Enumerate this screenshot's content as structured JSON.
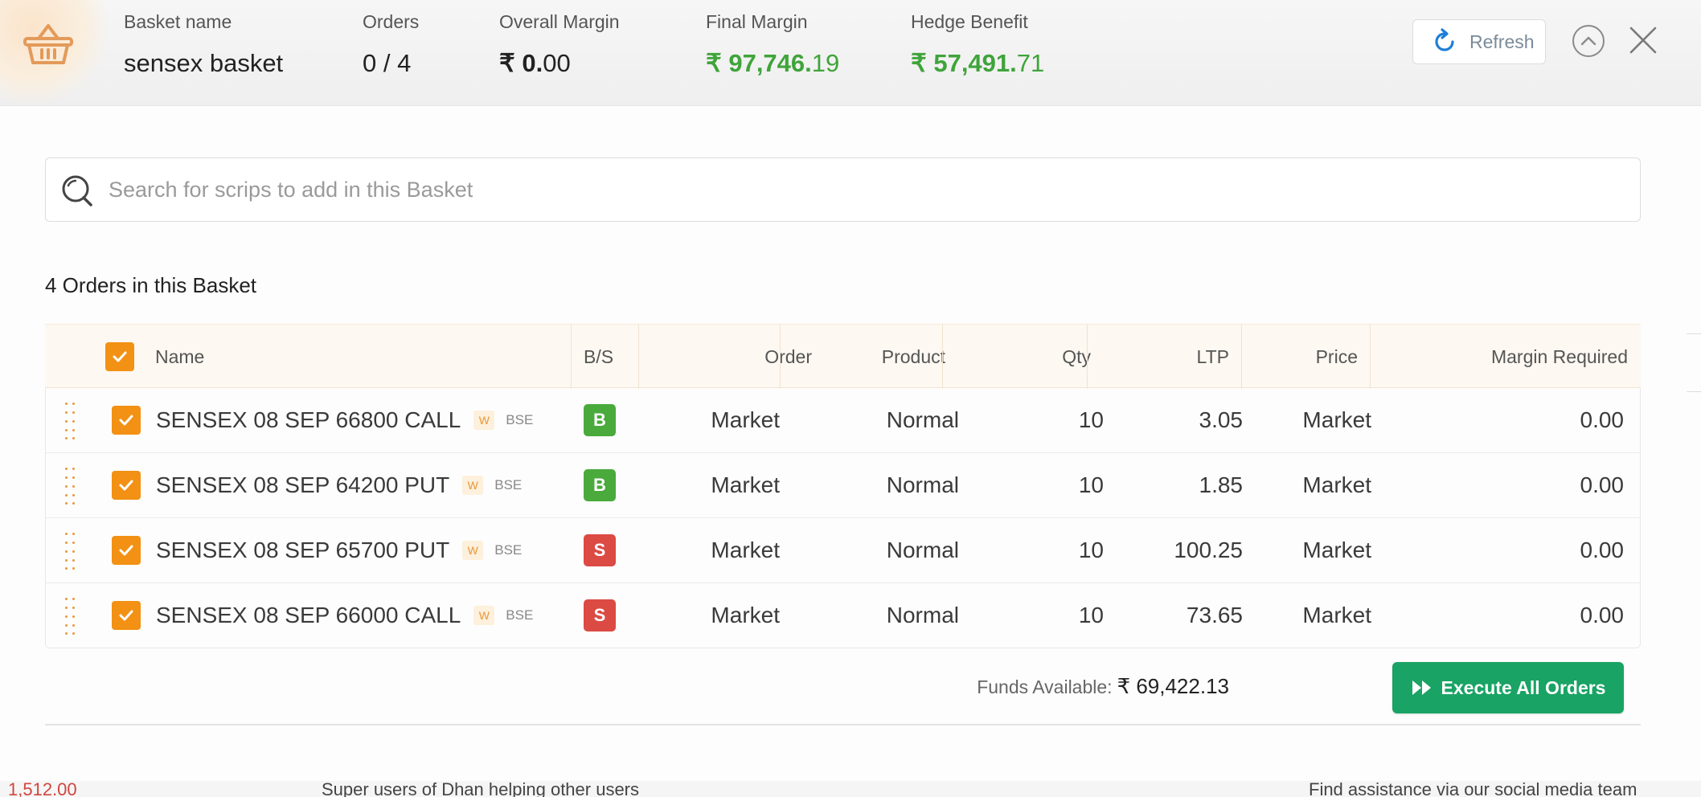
{
  "header": {
    "basket_name_label": "Basket name",
    "basket_name": "sensex basket",
    "orders_label": "Orders",
    "orders_value": "0 / 4",
    "overall_margin_label": "Overall Margin",
    "overall_margin_int": "₹ 0.",
    "overall_margin_dec": "00",
    "final_margin_label": "Final Margin",
    "final_margin_int": "₹ 97,746.",
    "final_margin_dec": "19",
    "hedge_benefit_label": "Hedge Benefit",
    "hedge_benefit_int": "₹ 57,491.",
    "hedge_benefit_dec": "71",
    "refresh_label": "Refresh",
    "icons": [
      "basket-icon",
      "refresh-icon",
      "collapse-up-icon",
      "close-icon"
    ]
  },
  "search": {
    "placeholder": "Search for scrips to add in this Basket"
  },
  "orders_title": "4 Orders in this Basket",
  "table": {
    "headers": {
      "name": "Name",
      "bs": "B/S",
      "order": "Order",
      "product": "Product",
      "qty": "Qty",
      "ltp": "LTP",
      "price": "Price",
      "margin": "Margin Required"
    },
    "rows": [
      {
        "name": "SENSEX 08 SEP 66800 CALL",
        "tag": "W",
        "exchange": "BSE",
        "bs": "B",
        "order": "Market",
        "product": "Normal",
        "qty": "10",
        "ltp": "3.05",
        "price": "Market",
        "margin": "0.00"
      },
      {
        "name": "SENSEX 08 SEP 64200 PUT",
        "tag": "W",
        "exchange": "BSE",
        "bs": "B",
        "order": "Market",
        "product": "Normal",
        "qty": "10",
        "ltp": "1.85",
        "price": "Market",
        "margin": "0.00"
      },
      {
        "name": "SENSEX 08 SEP 65700 PUT",
        "tag": "W",
        "exchange": "BSE",
        "bs": "S",
        "order": "Market",
        "product": "Normal",
        "qty": "10",
        "ltp": "100.25",
        "price": "Market",
        "margin": "0.00"
      },
      {
        "name": "SENSEX 08 SEP 66000 CALL",
        "tag": "W",
        "exchange": "BSE",
        "bs": "S",
        "order": "Market",
        "product": "Normal",
        "qty": "10",
        "ltp": "73.65",
        "price": "Market",
        "margin": "0.00"
      }
    ]
  },
  "footer": {
    "funds_label": "Funds Available:",
    "funds_value": "₹ 69,422.13",
    "execute_label": "Execute All Orders"
  },
  "background": {
    "left_text": "1,512.00",
    "middle_text": "Super users of Dhan helping other users",
    "right_text": "Find assistance via our social media team"
  },
  "colors": {
    "accent_orange": "#f29114",
    "positive_green": "#3fa43a",
    "buy_green": "#4aaa3c",
    "sell_red": "#dc4a44",
    "execute_green": "#19a364"
  }
}
